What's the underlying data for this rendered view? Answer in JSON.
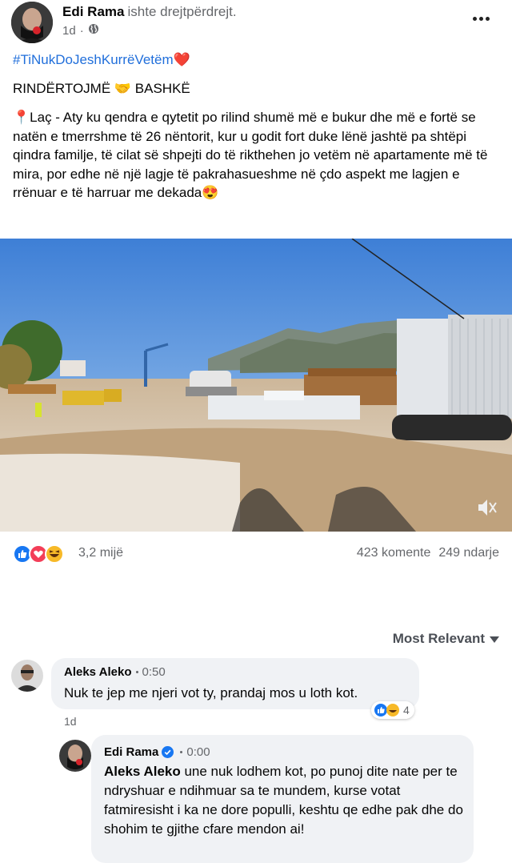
{
  "post": {
    "author": "Edi Rama",
    "status": "ishte drejtpërdrejt.",
    "time": "1d",
    "hashtag": "#TiNukDoJeshKurrëVetëm❤️",
    "title": "RINDËRTOJMË 🤝 BASHKË",
    "body": "📍Laç - Aty ku qendra e qytetit po rilind shumë më e bukur dhe më e fortë se natën e tmerrshme të 26 nëntorit, kur u godit fort duke lënë jashtë pa shtëpi qindra familje, të cilat së shpejti do të rikthehen jo vetëm në apartamente më të mira, por edhe në një lagje të pakrahasueshme në çdo aspekt me lagjen e rrënuar e të harruar me dekada😍",
    "reactions_count": "3,2 mijë",
    "comments_count": "423 komente",
    "shares_count": "249 ndarje"
  },
  "comments_filter": "Most Relevant",
  "comments": [
    {
      "author": "Aleks Aleko",
      "time": "0:50",
      "text": "Nuk te jep me njeri vot ty, prandaj mos u loth kot.",
      "age": "1d",
      "reaction_count": "4"
    }
  ],
  "reply": {
    "author": "Edi Rama",
    "time": "0:00",
    "mention": "Aleks Aleko",
    "text": " une nuk lodhem kot, po punoj dite nate per te ndryshuar e ndihmuar sa te mundem, kurse votat fatmiresisht i ka ne dore populli, keshtu qe edhe pak dhe do shohim te gjithe cfare mendon ai!"
  },
  "colors": {
    "link": "#216fdb",
    "like": "#1877f2",
    "love": "#f33e58",
    "haha": "#f7b928",
    "verified": "#1877f2"
  }
}
